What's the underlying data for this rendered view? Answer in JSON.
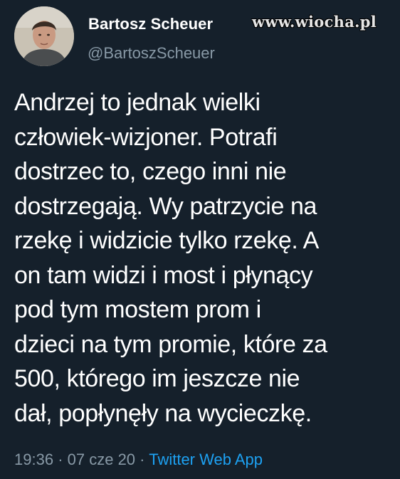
{
  "watermark": "www.wiocha.pl",
  "author": {
    "display_name": "Bartosz Scheuer",
    "handle": "@BartoszScheuer"
  },
  "tweet": {
    "lines": [
      "Andrzej to jednak wielki",
      "człowiek-wizjoner. Potrafi",
      "dostrzec to, czego inni nie",
      "dostrzegają. Wy patrzycie na",
      "rzekę i widzicie tylko rzekę. A",
      "on tam widzi i most i płynący",
      "pod tym mostem prom i",
      "dzieci na tym promie, które za",
      "500, którego im jeszcze nie",
      "dał, popłynęły na wycieczkę."
    ]
  },
  "meta": {
    "time": "19:36",
    "separator": "·",
    "date": "07 cze 20",
    "source": "Twitter Web App"
  },
  "colors": {
    "background": "#15202b",
    "text": "#ffffff",
    "secondary": "#8899a6",
    "link": "#1da1f2"
  }
}
